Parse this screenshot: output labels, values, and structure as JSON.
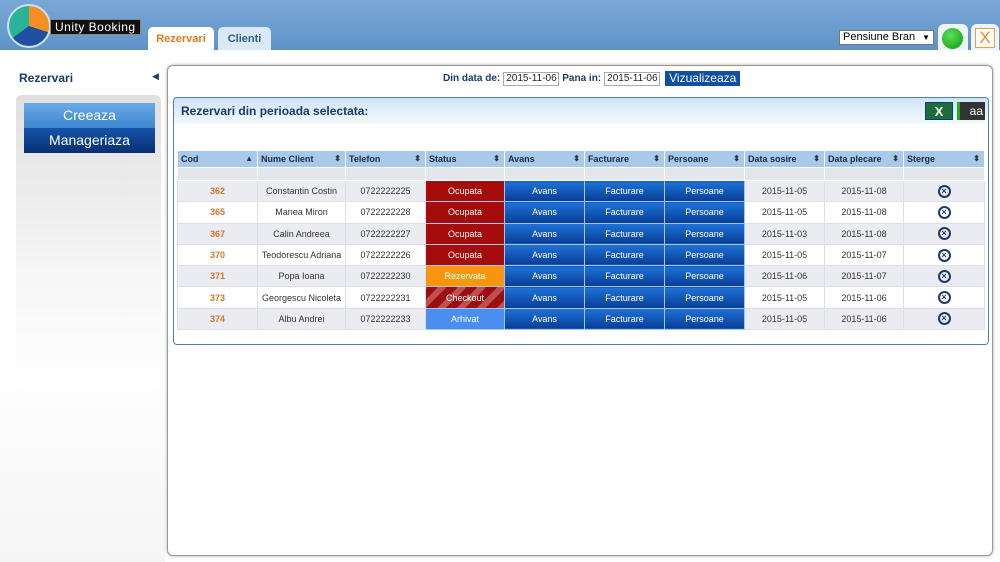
{
  "app": {
    "logo_text": "Unity Booking",
    "tabs": [
      {
        "label": "Rezervari",
        "active": true
      },
      {
        "label": "Clienti",
        "active": false
      }
    ],
    "property": "Pensiune Bran",
    "online_status_color": "#1aa51a",
    "close_label": "X"
  },
  "sidebar": {
    "title": "Rezervari",
    "items": [
      {
        "label": "Creeaza"
      },
      {
        "label": "Manageriaza"
      }
    ]
  },
  "filter": {
    "from_label": "Din data de:",
    "from_value": "2015-11-06",
    "to_label": "Pana in:",
    "to_value": "2015-11-06",
    "button": "Vizualizeaza"
  },
  "panel": {
    "title": "Rezervari din perioada selectata:",
    "excel_label": "X",
    "font_label": "aa"
  },
  "table": {
    "columns": [
      "Cod",
      "Nume Client",
      "Telefon",
      "Status",
      "Avans",
      "Facturare",
      "Persoane",
      "Data sosire",
      "Data plecare",
      "Sterge"
    ],
    "rows": [
      {
        "cod": "362",
        "client": "Constantin Costin",
        "telefon": "0722222225",
        "status": "Ocupata",
        "avans": "Avans",
        "facturare": "Facturare",
        "persoane": "Persoane",
        "sosire": "2015-11-05",
        "plecare": "2015-11-08"
      },
      {
        "cod": "365",
        "client": "Manea Miron",
        "telefon": "0722222228",
        "status": "Ocupata",
        "avans": "Avans",
        "facturare": "Facturare",
        "persoane": "Persoane",
        "sosire": "2015-11-05",
        "plecare": "2015-11-08"
      },
      {
        "cod": "367",
        "client": "Calin Andreea",
        "telefon": "0722222227",
        "status": "Ocupata",
        "avans": "Avans",
        "facturare": "Facturare",
        "persoane": "Persoane",
        "sosire": "2015-11-03",
        "plecare": "2015-11-08"
      },
      {
        "cod": "370",
        "client": "Teodorescu Adriana",
        "telefon": "0722222226",
        "status": "Ocupata",
        "avans": "Avans",
        "facturare": "Facturare",
        "persoane": "Persoane",
        "sosire": "2015-11-05",
        "plecare": "2015-11-07"
      },
      {
        "cod": "371",
        "client": "Popa Ioana",
        "telefon": "0722222230",
        "status": "Rezervata",
        "avans": "Avans",
        "facturare": "Facturare",
        "persoane": "Persoane",
        "sosire": "2015-11-06",
        "plecare": "2015-11-07"
      },
      {
        "cod": "373",
        "client": "Georgescu Nicoleta",
        "telefon": "0722222231",
        "status": "Checkout",
        "avans": "Avans",
        "facturare": "Facturare",
        "persoane": "Persoane",
        "sosire": "2015-11-05",
        "plecare": "2015-11-06"
      },
      {
        "cod": "374",
        "client": "Albu Andrei",
        "telefon": "0722222233",
        "status": "Arhivat",
        "avans": "Avans",
        "facturare": "Facturare",
        "persoane": "Persoane",
        "sosire": "2015-11-05",
        "plecare": "2015-11-06"
      }
    ]
  },
  "status_colors": {
    "Ocupata": "#a50c0c",
    "Rezervata": "#f7950f",
    "Checkout": "#9a1010",
    "Arhivat": "#4a8ef0"
  }
}
